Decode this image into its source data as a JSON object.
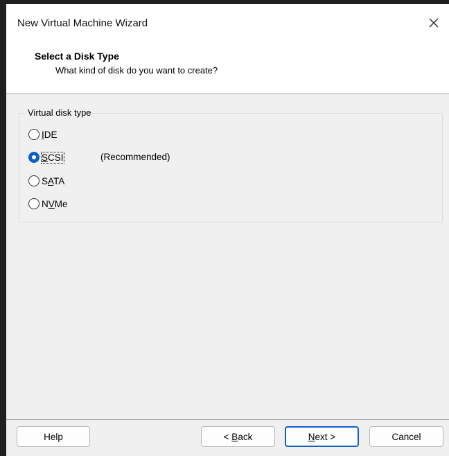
{
  "window": {
    "title": "New Virtual Machine Wizard",
    "close_icon": "close-icon"
  },
  "header": {
    "title": "Select a Disk Type",
    "subtitle": "What kind of disk do you want to create?"
  },
  "disk_type_group": {
    "legend": "Virtual disk type",
    "options": [
      {
        "label": "IDE",
        "mnemonic": "I",
        "rest": "DE",
        "selected": false
      },
      {
        "label": "SCSI",
        "mnemonic": "S",
        "rest": "CSI",
        "selected": true,
        "note": "(Recommended)"
      },
      {
        "label": "SATA",
        "pre": "S",
        "mnemonic": "A",
        "rest": "TA",
        "selected": false
      },
      {
        "label": "NVMe",
        "pre": "N",
        "mnemonic": "V",
        "rest": "Me",
        "selected": false
      }
    ]
  },
  "buttons": {
    "help": "Help",
    "back_prefix": "< ",
    "back_mnemonic": "B",
    "back_rest": "ack",
    "next_mnemonic": "N",
    "next_rest": "ext >",
    "cancel": "Cancel"
  },
  "colors": {
    "accent": "#0f5fc8",
    "dialog_bg": "#f0f0f0",
    "header_bg": "#ffffff"
  }
}
